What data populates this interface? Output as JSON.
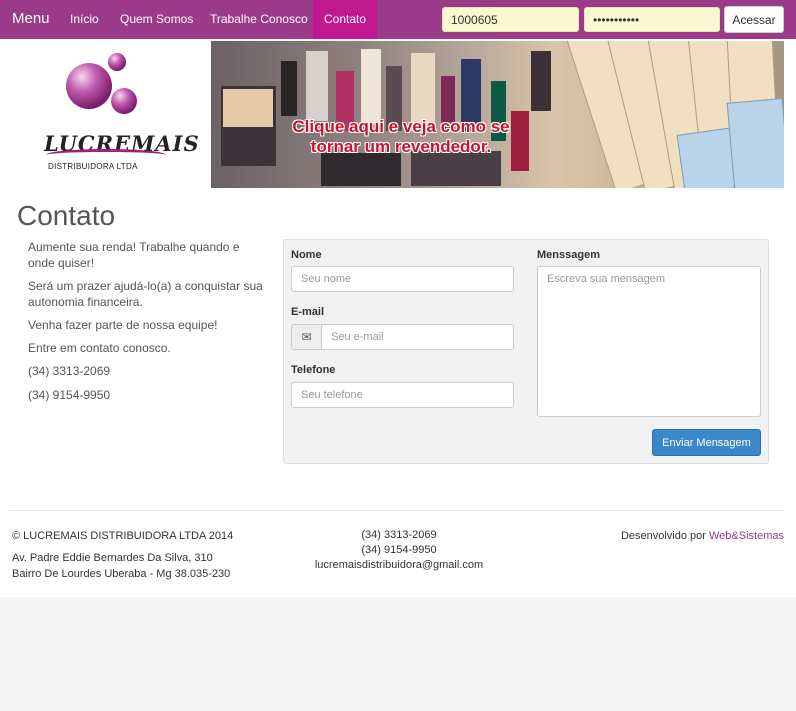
{
  "nav": {
    "brand": "Menu",
    "links": [
      "Início",
      "Quem Somos",
      "Trabalhe Conosco",
      "Contato"
    ]
  },
  "login": {
    "user_value": "1000605",
    "password_value": "•••••••••••",
    "submit_label": "Acessar"
  },
  "logo": {
    "name": "LUCREMAIS",
    "subtitle": "DISTRIBUIDORA LTDA"
  },
  "banner": {
    "text": "Clique aqui e veja como se tornar um revendedor."
  },
  "page": {
    "title": "Contato"
  },
  "info": {
    "paragraphs": [
      "Aumente sua renda! Trabalhe quando e onde quiser!",
      "Será um prazer ajudá-lo(a) a conquistar sua autonomia financeira.",
      "Venha fazer parte de nossa equipe!",
      "Entre em contato conosco.",
      "(34) 3313-2069",
      "(34) 9154-9950"
    ]
  },
  "form": {
    "name_label": "Nome",
    "name_placeholder": "Seu nome",
    "email_label": "E-mail",
    "email_placeholder": "Seu e-mail",
    "phone_label": "Telefone",
    "phone_placeholder": "Seu telefone",
    "message_label": "Menssagem",
    "message_placeholder": "Escreva sua mensagem",
    "submit_label": "Enviar Mensagem"
  },
  "footer": {
    "copyright": "© LUCREMAIS DISTRIBUIDORA LTDA 2014",
    "address_line1": "Av. Padre Eddie Bernardes Da Silva, 310",
    "address_line2": "Bairro De Lourdes  Uberaba - Mg  38.035-230",
    "phone1": "(34) 3313-2069",
    "phone2": "(34) 9154-9950",
    "email": "lucremaisdistribuidora@gmail.com",
    "dev_prefix": "Desenvolvido por ",
    "dev_link": "Web&Sistemas"
  },
  "colors": {
    "navbar": "#9c3a8a",
    "active_tab": "#c0198f",
    "button_primary": "#3a87c9"
  },
  "icons": {
    "email_addon": "envelope-icon"
  }
}
